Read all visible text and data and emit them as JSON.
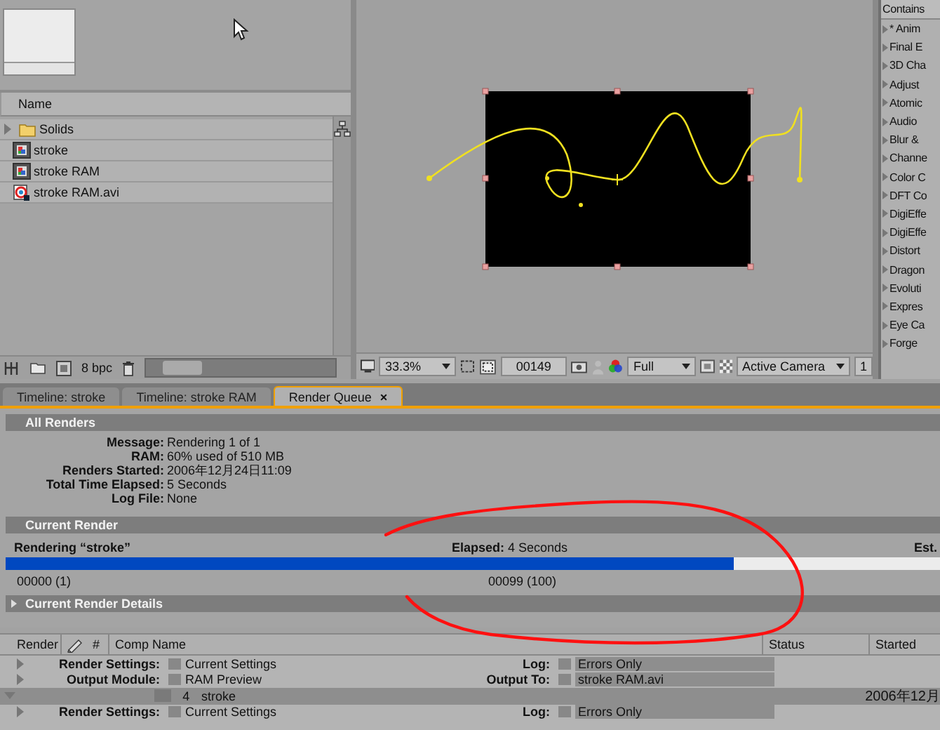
{
  "project": {
    "columns": [
      "Name"
    ],
    "items": [
      {
        "kind": "folder",
        "name": "Solids",
        "expanded": false
      },
      {
        "kind": "comp",
        "name": "stroke"
      },
      {
        "kind": "comp",
        "name": "stroke RAM"
      },
      {
        "kind": "footage",
        "name": "stroke RAM.avi"
      }
    ],
    "bit_depth": "8 bpc"
  },
  "viewer": {
    "zoom": "33.3%",
    "timecode": "00149",
    "resolution": "Full",
    "camera": "Active Camera",
    "views": "1"
  },
  "effects": {
    "header": "Contains",
    "items": [
      "* Anim",
      "Final E",
      "3D Cha",
      "Adjust",
      "Atomic",
      "Audio",
      "Blur & ",
      "Channe",
      "Color C",
      "DFT Co",
      "DigiEffe",
      "DigiEffe",
      "Distort",
      "Dragon",
      "Evoluti",
      "Expres",
      "Eye Ca",
      "Forge"
    ]
  },
  "tabs": [
    {
      "label": "Timeline: stroke",
      "selected": false
    },
    {
      "label": "Timeline: stroke RAM",
      "selected": false
    },
    {
      "label": "Render Queue",
      "selected": true,
      "close": "×"
    }
  ],
  "render_queue": {
    "all_renders": {
      "title": "All Renders",
      "fields": [
        {
          "label": "Message:",
          "value": "Rendering 1 of 1"
        },
        {
          "label": "RAM:",
          "value": "60% used of 510 MB"
        },
        {
          "label": "Renders Started:",
          "value": "2006年12月24日11:09"
        },
        {
          "label": "Total Time Elapsed:",
          "value": "5 Seconds"
        },
        {
          "label": "Log File:",
          "value": "None"
        }
      ]
    },
    "current_render": {
      "title": "Current Render",
      "rendering": "Rendering “stroke”",
      "elapsed": "**Elapsed:** 4 Seconds",
      "estimate": "Est.",
      "level": 0.78,
      "start_frame": "00000 (1)",
      "end_frame": "00099 (100)"
    },
    "details": {
      "title": "Current Render Details",
      "expanded": false
    },
    "table": {
      "columns": [
        "Render",
        "#",
        "Comp Name",
        "Status",
        "Started"
      ],
      "rows": [
        {
          "kind": "settings",
          "expanded": false,
          "label": "Render Settings:",
          "value": "Current Settings",
          "side_label": "Log:",
          "side_value": "Errors Only"
        },
        {
          "kind": "settings",
          "expanded": false,
          "label": "Output Module:",
          "value": "RAM Preview",
          "side_label": "Output To:",
          "side_value": "stroke RAM.avi"
        },
        {
          "kind": "item",
          "expanded": true,
          "render_checked": false,
          "number": "4",
          "comp": "stroke",
          "started": "2006年12月"
        },
        {
          "kind": "settings",
          "expanded": false,
          "label": "Render Settings:",
          "value": "Current Settings",
          "side_label": "Log:",
          "side_value": "Errors Only"
        }
      ]
    }
  }
}
